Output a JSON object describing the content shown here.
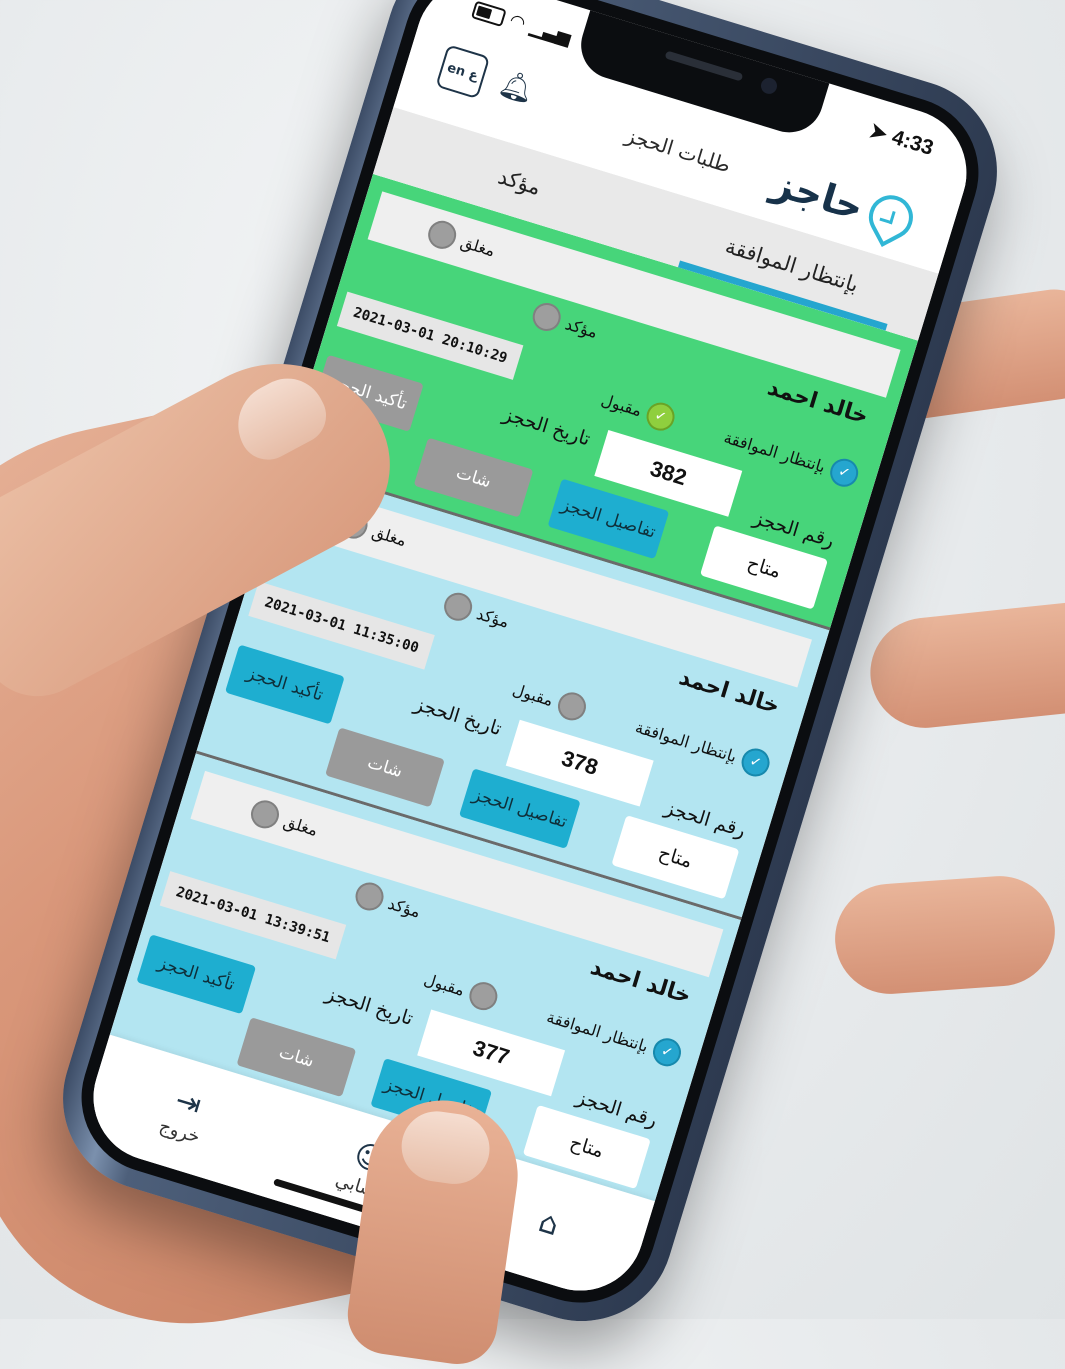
{
  "status_bar": {
    "time": "4:33",
    "signal_icon": "signal-bars-icon",
    "wifi_icon": "wifi-icon",
    "battery_icon": "battery-icon"
  },
  "header": {
    "title": "طلبات الحجز",
    "logo_text": "حاجز",
    "logo_icon": "location-pin-clock-icon",
    "language_icon": "en-ar-language-icon",
    "notification_icon": "bell-icon"
  },
  "tabs": [
    {
      "label": "بإنتظار الموافقة",
      "active": true
    },
    {
      "label": "مؤكد",
      "active": false
    }
  ],
  "status_options": {
    "waiting": "بإنتظار الموافقة",
    "accepted": "مقبول",
    "confirmed": "مؤكد",
    "closed": "مغلق"
  },
  "labels": {
    "booking_number": "رقم الحجز",
    "booking_date": "تاريخ الحجز",
    "availability": "متاح",
    "details_button": "تفاصيل الحجز",
    "chat_button": "شات",
    "confirm_button": "تأكيد الحجز"
  },
  "bookings": [
    {
      "customer": "خالد احمد",
      "booking_number": "382",
      "date": "2021-03-01 20:10:29",
      "theme": "green",
      "state": "accepted"
    },
    {
      "customer": "خالد احمد",
      "booking_number": "378",
      "date": "2021-03-01 11:35:00",
      "theme": "blue",
      "state": "waiting"
    },
    {
      "customer": "خالد احمد",
      "booking_number": "377",
      "date": "2021-03-01 13:39:51",
      "theme": "blue",
      "state": "waiting"
    }
  ],
  "bottom_nav": [
    {
      "label": "",
      "icon": "home-icon"
    },
    {
      "label": "حسابي",
      "icon": "user-icon"
    },
    {
      "label": "خروج",
      "icon": "logout-icon"
    }
  ],
  "colors": {
    "green_card": "#47d57a",
    "blue_card": "#b3e5f1",
    "accent": "#25a6cf",
    "logo_dark": "#17324a"
  }
}
